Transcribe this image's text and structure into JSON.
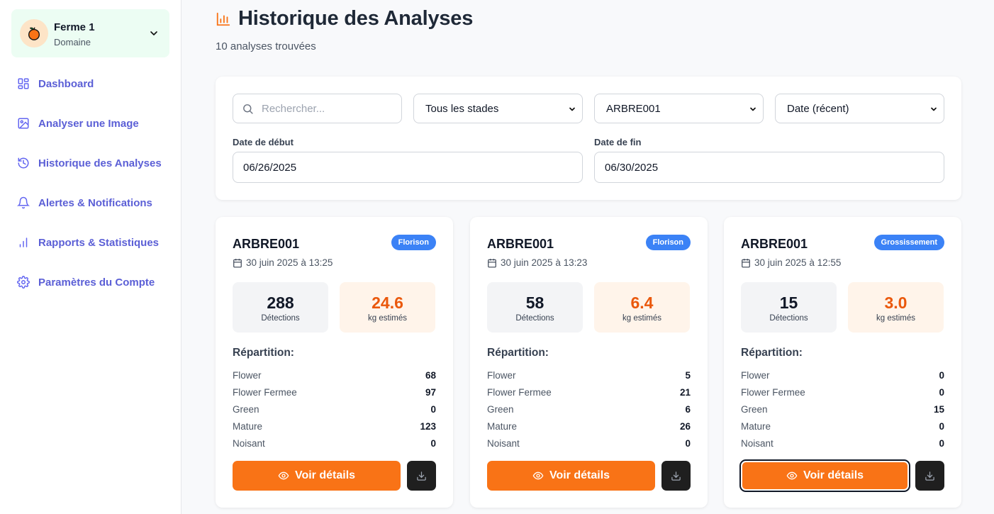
{
  "sidebar": {
    "farm": {
      "name": "Ferme 1",
      "subtitle": "Domaine",
      "avatar_icon": "orange-fruit-icon"
    },
    "items": [
      {
        "label": "Dashboard",
        "icon": "dashboard-grid-icon"
      },
      {
        "label": "Analyser une Image",
        "icon": "image-icon"
      },
      {
        "label": "Historique des Analyses",
        "icon": "history-icon"
      },
      {
        "label": "Alertes & Notifications",
        "icon": "bell-icon"
      },
      {
        "label": "Rapports & Statistiques",
        "icon": "bar-chart-icon"
      },
      {
        "label": "Paramètres du Compte",
        "icon": "gear-icon"
      }
    ]
  },
  "header": {
    "title": "Historique des Analyses",
    "title_icon": "bar-chart-icon",
    "count_text": "10 analyses trouvées"
  },
  "filters": {
    "search_placeholder": "Rechercher...",
    "search_value": "",
    "stage_select": "Tous les stades",
    "tree_select": "ARBRE001",
    "sort_select": "Date (récent)",
    "start_label": "Date de début",
    "start_value": "06/26/2025",
    "end_label": "Date de fin",
    "end_value": "06/30/2025"
  },
  "cards": [
    {
      "id": "ARBRE001",
      "badge": "Florison",
      "date": "30 juin 2025 à 13:25",
      "detections": "288",
      "detections_label": "Détections",
      "kg": "24.6",
      "kg_label": "kg estimés",
      "rep_title": "Répartition:",
      "rep": [
        {
          "label": "Flower",
          "value": "68"
        },
        {
          "label": "Flower Fermee",
          "value": "97"
        },
        {
          "label": "Green",
          "value": "0"
        },
        {
          "label": "Mature",
          "value": "123"
        },
        {
          "label": "Noisant",
          "value": "0"
        }
      ],
      "details_label": "Voir détails"
    },
    {
      "id": "ARBRE001",
      "badge": "Florison",
      "date": "30 juin 2025 à 13:23",
      "detections": "58",
      "detections_label": "Détections",
      "kg": "6.4",
      "kg_label": "kg estimés",
      "rep_title": "Répartition:",
      "rep": [
        {
          "label": "Flower",
          "value": "5"
        },
        {
          "label": "Flower Fermee",
          "value": "21"
        },
        {
          "label": "Green",
          "value": "6"
        },
        {
          "label": "Mature",
          "value": "26"
        },
        {
          "label": "Noisant",
          "value": "0"
        }
      ],
      "details_label": "Voir détails"
    },
    {
      "id": "ARBRE001",
      "badge": "Grossissement",
      "date": "30 juin 2025 à 12:55",
      "detections": "15",
      "detections_label": "Détections",
      "kg": "3.0",
      "kg_label": "kg estimés",
      "rep_title": "Répartition:",
      "rep": [
        {
          "label": "Flower",
          "value": "0"
        },
        {
          "label": "Flower Fermee",
          "value": "0"
        },
        {
          "label": "Green",
          "value": "15"
        },
        {
          "label": "Mature",
          "value": "0"
        },
        {
          "label": "Noisant",
          "value": "0"
        }
      ],
      "details_label": "Voir détails"
    }
  ],
  "colors": {
    "accent_orange": "#f97316",
    "nav_purple": "#6366f1",
    "badge_blue": "#3b82f6",
    "farm_bg": "#ecfdf3"
  }
}
